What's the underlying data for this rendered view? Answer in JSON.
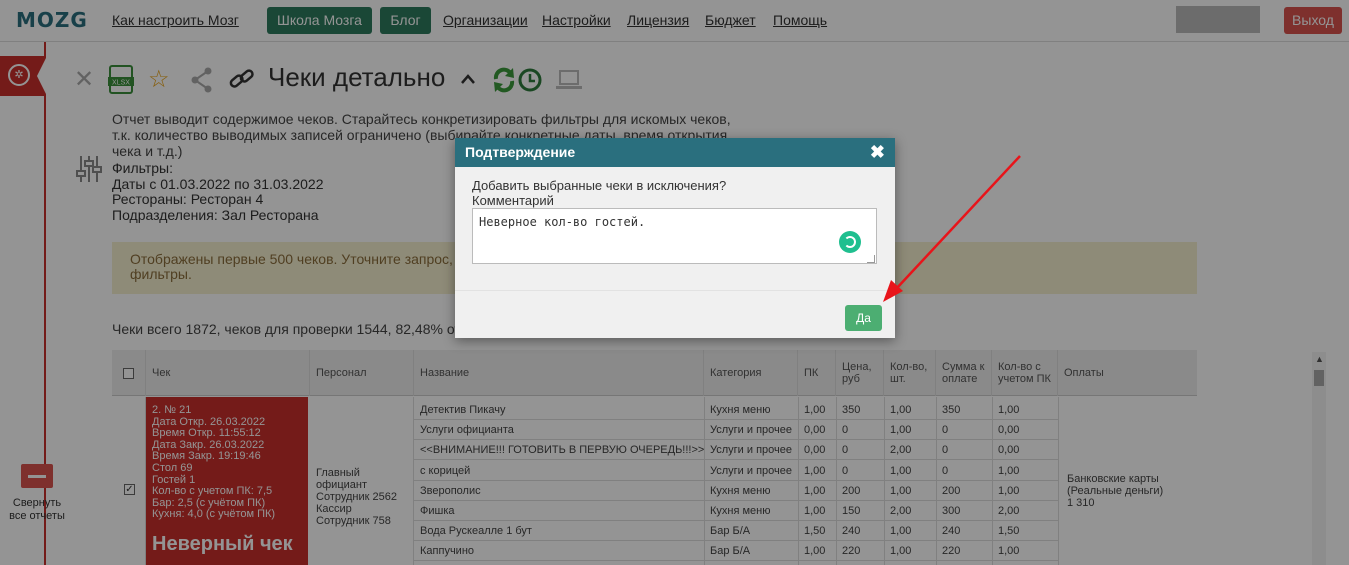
{
  "nav": {
    "logo": "MOZG",
    "how_to": "Как настроить Мозг",
    "school": "Школа Мозга",
    "blog": "Блог",
    "orgs": "Организации",
    "settings": "Настройки",
    "license": "Лицензия",
    "budget": "Бюджет",
    "help": "Помощь",
    "logout": "Выход"
  },
  "sidebar": {
    "collapse_label": "Свернуть все отчеты"
  },
  "header": {
    "title": "Чеки детально",
    "description": "Отчет выводит содержимое чеков. Старайтесь конкретизировать фильтры для искомых чеков, т.к. количество выводимых записей ограничено (выбирайте конкретные даты, время открытия чека и т.д.)"
  },
  "filters": {
    "heading": "Фильтры:",
    "dates_label": "Даты",
    "dates_value": "с 01.03.2022 по 31.03.2022",
    "restaurants_label": "Рестораны:",
    "restaurants_value": "Ресторан 4",
    "divisions_label": "Подразделения:",
    "divisions_value": "Зал Ресторана"
  },
  "warning": {
    "line1": "Отображены первые 500 чеков. Уточните запрос, за",
    "line2": "фильтры."
  },
  "counts": "Чеки всего 1872, чеков для проверки 1544, 82,48% от",
  "table": {
    "headers": [
      "Чек",
      "Персонал",
      "Название",
      "Категория",
      "ПК",
      "Цена, руб",
      "Кол-во, шт.",
      "Сумма к оплате",
      "Кол-во с учетом ПК",
      "Оплаты"
    ],
    "check": {
      "lines": [
        "2. № 21",
        "Дата Откр. 26.03.2022",
        "Время Откр. 11:55:12",
        "Дата Закр. 26.03.2022",
        "Время Закр. 19:19:46",
        "Стол 69",
        "Гостей 1",
        "Кол-во с учетом ПК: 7,5",
        "Бар: 2,5 (с учётом ПК)",
        "Кухня: 4,0 (с учётом ПК)"
      ],
      "status": "Неверный чек"
    },
    "staff": [
      "Главный официант",
      "Сотрудник 2562",
      "Кассир",
      "Сотрудник 758"
    ],
    "rows": [
      [
        "Детектив Пикачу",
        "Кухня меню",
        "1,00",
        "350",
        "1,00",
        "350",
        "1,00"
      ],
      [
        "Услуги официанта",
        "Услуги и прочее",
        "0,00",
        "0",
        "1,00",
        "0",
        "0,00"
      ],
      [
        "<<ВНИМАНИЕ!!! ГОТОВИТЬ В ПЕРВУЮ ОЧЕРЕДЬ!!!>>",
        "Услуги и прочее",
        "0,00",
        "0",
        "2,00",
        "0",
        "0,00"
      ],
      [
        "с корицей",
        "Услуги и прочее",
        "1,00",
        "0",
        "1,00",
        "0",
        "1,00"
      ],
      [
        "Зверополис",
        "Кухня меню",
        "1,00",
        "200",
        "1,00",
        "200",
        "1,00"
      ],
      [
        "Фишка",
        "Кухня меню",
        "1,00",
        "150",
        "2,00",
        "300",
        "2,00"
      ],
      [
        "Вода Рускеалле 1 бут",
        "Бар Б/А",
        "1,50",
        "240",
        "1,00",
        "240",
        "1,50"
      ],
      [
        "Каппучино",
        "Бар Б/А",
        "1,00",
        "220",
        "1,00",
        "220",
        "1,00"
      ]
    ],
    "payment": [
      "Банковские карты",
      "(Реальные деньги)",
      "1 310"
    ]
  },
  "modal": {
    "title": "Подтверждение",
    "question": "Добавить выбранные чеки в исключения?",
    "comment_label": "Комментарий",
    "comment_value": "Неверное кол-во гостей.",
    "ok": "Да"
  },
  "colors": {
    "teal": "#2a6f7e",
    "green": "#2e7a5e",
    "red": "#c9302c",
    "ok_green": "#4cae72",
    "annotation": "#e8141a"
  }
}
